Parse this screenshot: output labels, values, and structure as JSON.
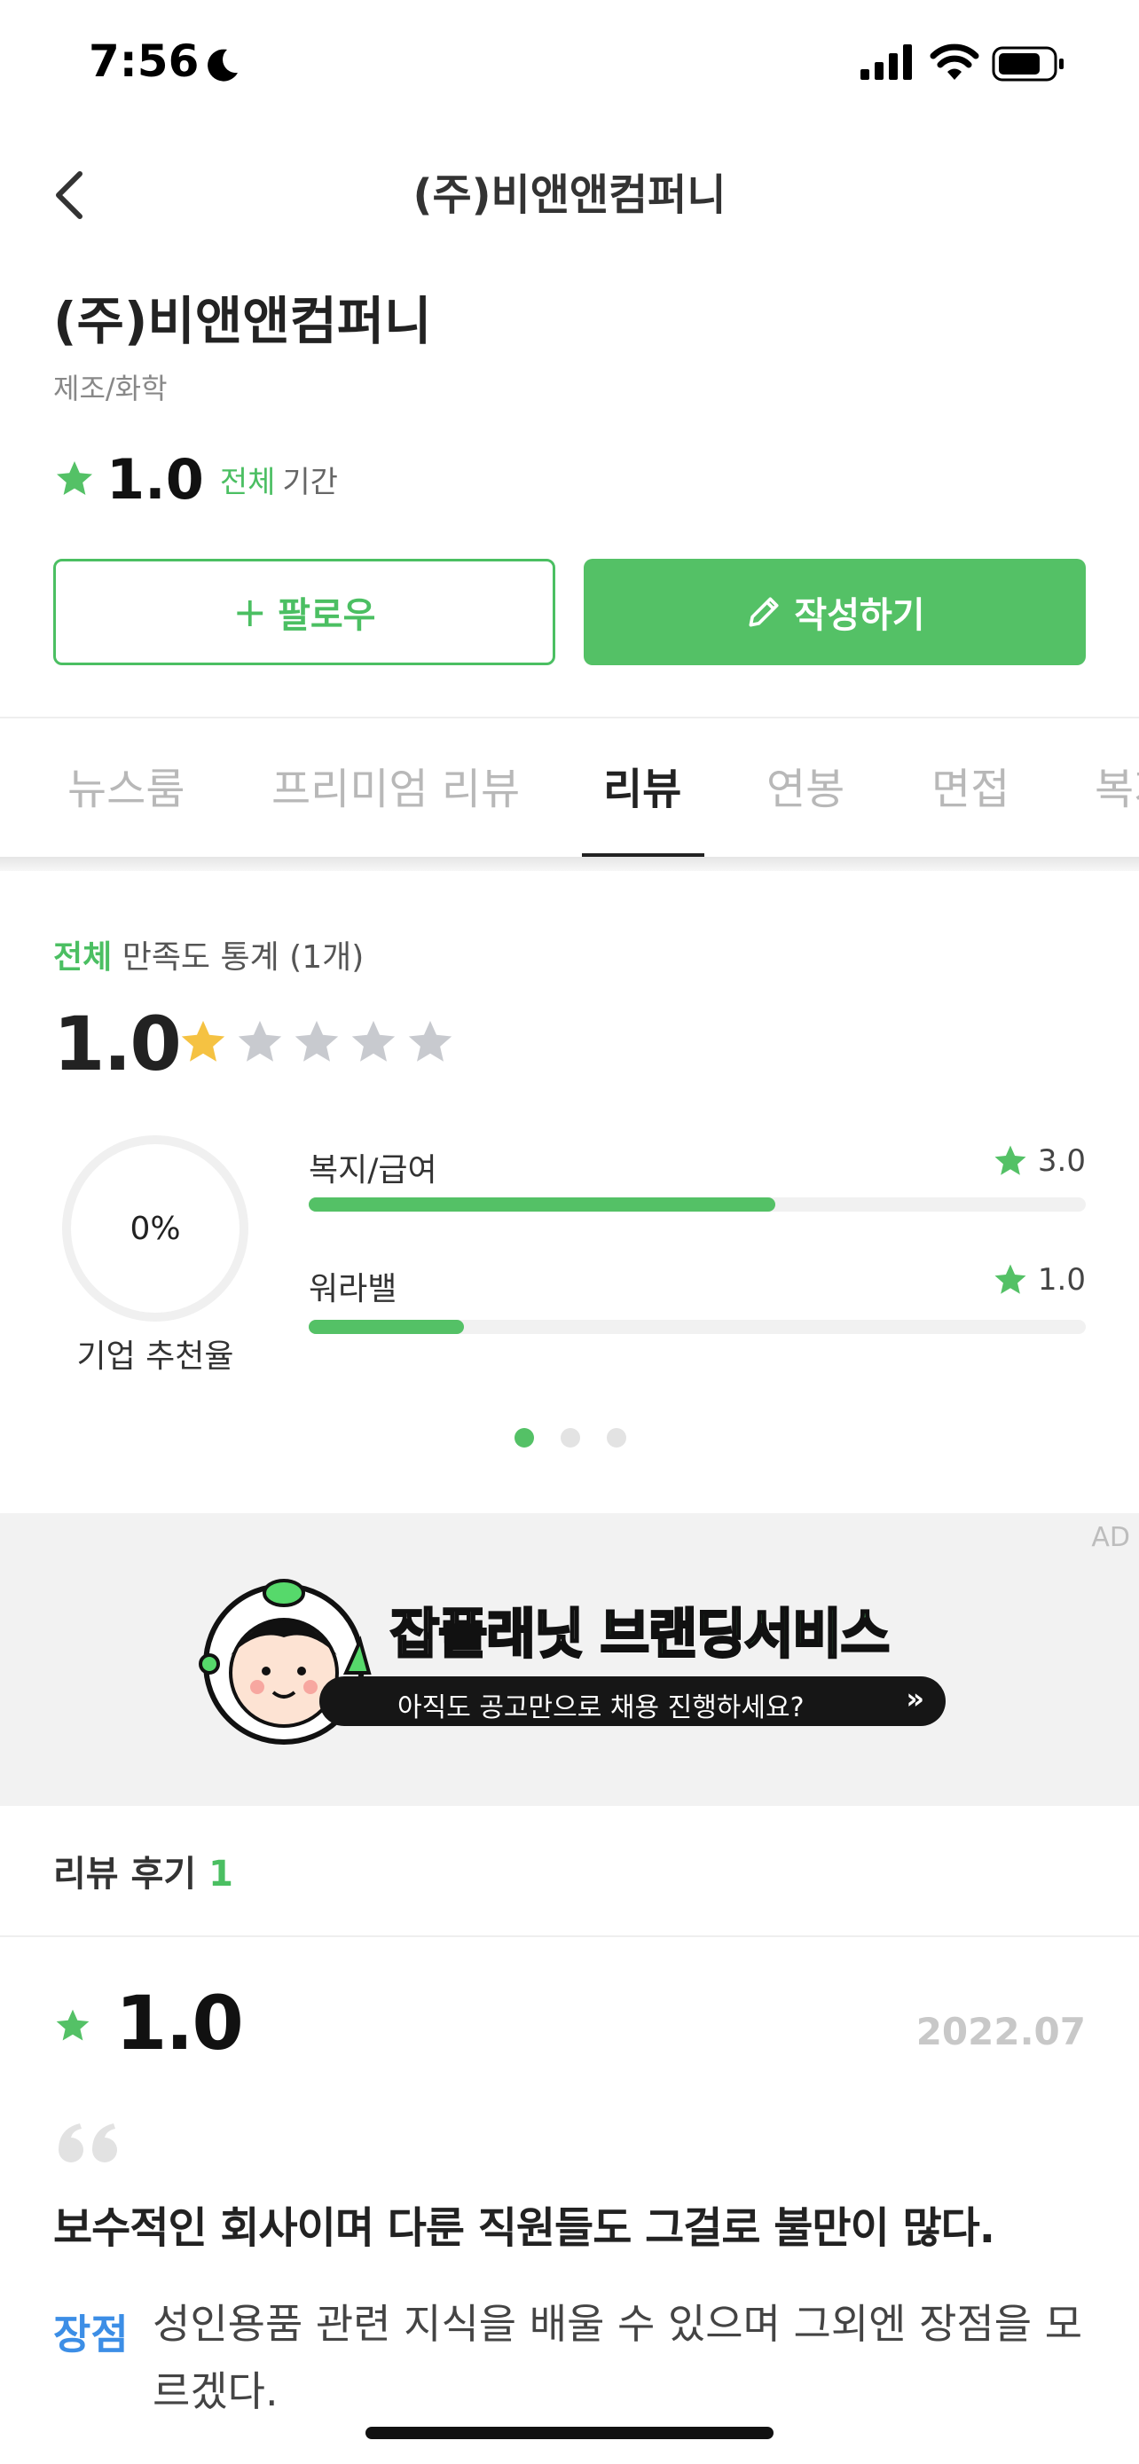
{
  "status_bar": {
    "time": "7:56"
  },
  "nav": {
    "title": "(주)비앤앤컴퍼니"
  },
  "company": {
    "name": "(주)비앤앤컴퍼니",
    "category": "제조/화학",
    "rating": "1.0",
    "period_link": "전체",
    "period_label": "기간"
  },
  "actions": {
    "follow_label": "팔로우",
    "write_label": "작성하기"
  },
  "tabs": [
    "뉴스룸",
    "프리미엄 리뷰",
    "리뷰",
    "연봉",
    "면접",
    "복지"
  ],
  "stats": {
    "title_accent": "전체",
    "title_rest": " 만족도 통계 (1개)",
    "score": "1.0",
    "stars_filled": 1,
    "stars_total": 5,
    "recommend_rate": "0%",
    "recommend_label": "기업 추천율",
    "bars": [
      {
        "label": "복지/급여",
        "score": "3.0",
        "fraction": 0.6
      },
      {
        "label": "워라밸",
        "score": "1.0",
        "fraction": 0.2
      }
    ],
    "pager": {
      "total": 3,
      "active": 0
    }
  },
  "ad": {
    "tag": "AD",
    "headline_part1": "잡플래닛",
    "headline_part2": "브랜딩서비스",
    "subtext": "아직도 공고만으로 채용 진행하세요?",
    "arrow": "»"
  },
  "reviews": {
    "header_label": "리뷰 후기",
    "count": "1",
    "items": [
      {
        "score": "1.0",
        "date": "2022.07",
        "summary": "보수적인 회사이며 다룬 직원들도 그걸로 불만이 많다.",
        "pros_label": "장점",
        "pros_text": "성인용품 관련 지식을 배울 수 있으며 그외엔 장점을 모르겠다."
      }
    ]
  },
  "colors": {
    "accent": "#54c166",
    "star_gold": "#f5c242",
    "star_gray": "#c8cacf",
    "pros_blue": "#3c8ee6"
  }
}
